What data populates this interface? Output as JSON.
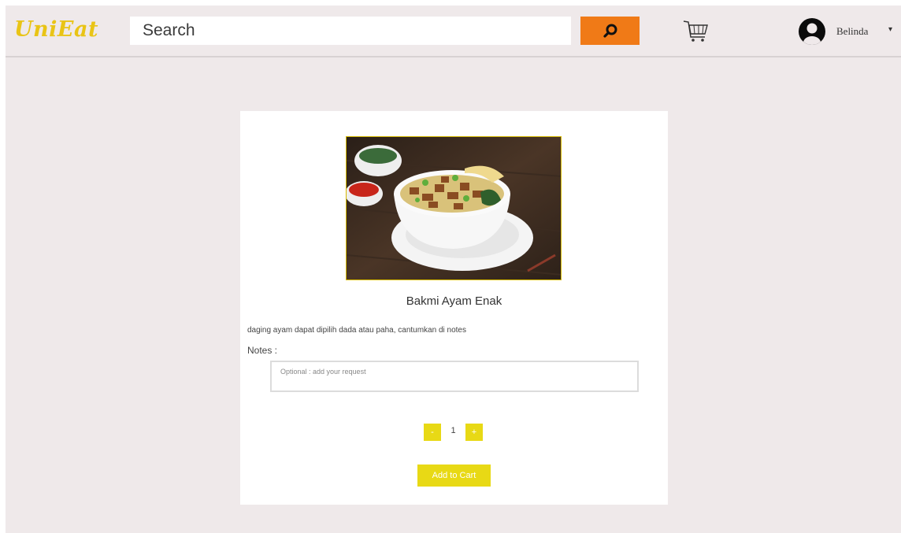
{
  "header": {
    "logo": "UniEat",
    "search_placeholder": "Search",
    "user_name": "Belinda",
    "dropdown_caret": "▾"
  },
  "product": {
    "name": "Bakmi Ayam Enak",
    "description": "daging ayam dapat dipilih dada atau paha, cantumkan di notes",
    "notes_label": "Notes :",
    "notes_placeholder": "Optional : add your request",
    "qty_minus": "-",
    "quantity": "1",
    "qty_plus": "+",
    "add_to_cart": "Add to Cart"
  },
  "colors": {
    "brand": "#e9c416",
    "search_button": "#f07a17",
    "accent": "#e8d915",
    "background": "#efe9ea"
  },
  "icons": {
    "search": "search-icon",
    "cart": "cart-icon",
    "user": "user-avatar-icon",
    "caret": "chevron-down-icon"
  }
}
